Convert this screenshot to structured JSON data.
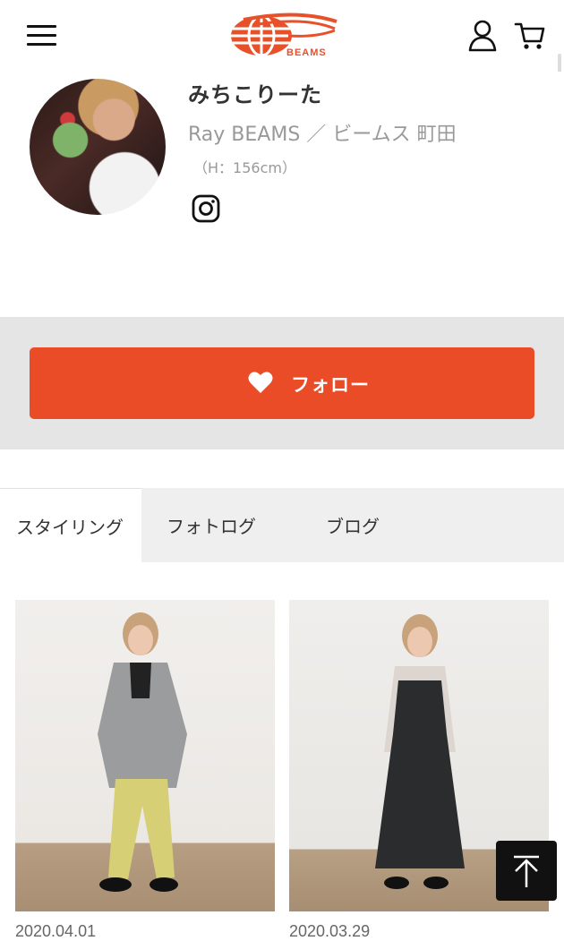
{
  "header": {
    "logo_text": "BEAMS",
    "brand_color": "#e8502a",
    "icons": [
      "hamburger-menu-icon",
      "user-icon",
      "cart-icon"
    ]
  },
  "profile": {
    "name": "みちこりーた",
    "shop": "Ray BEAMS ／ ビームス 町田",
    "height": "（H：156cm）",
    "social_icon": "instagram-icon"
  },
  "follow": {
    "label": "フォロー",
    "icon": "heart-icon",
    "color": "#e94c26"
  },
  "tabs": [
    {
      "label": "スタイリング",
      "active": true
    },
    {
      "label": "フォトログ",
      "active": false
    },
    {
      "label": "ブログ",
      "active": false
    }
  ],
  "posts": [
    {
      "date": "2020.04.01"
    },
    {
      "date": "2020.03.29"
    }
  ],
  "back_to_top": {
    "icon": "arrow-up-icon"
  }
}
